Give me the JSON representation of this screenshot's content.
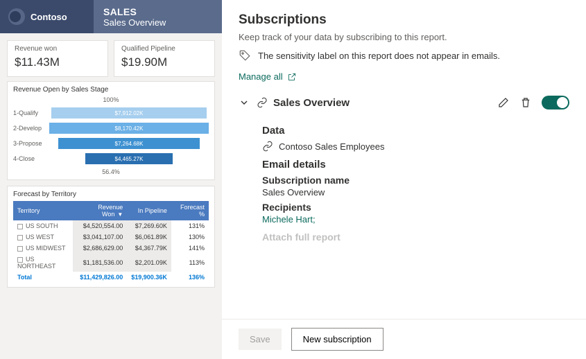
{
  "brand": {
    "name": "Contoso"
  },
  "nav": {
    "section": "SALES",
    "page": "Sales Overview"
  },
  "tiles": {
    "revenue_won": {
      "label": "Revenue won",
      "value": "$11.43M"
    },
    "qualified_pipeline": {
      "label": "Qualified Pipeline",
      "value": "$19.90M"
    }
  },
  "funnel": {
    "title": "Revenue Open by Sales Stage",
    "top_pct": "100%",
    "bottom_pct": "56.4%",
    "rows": [
      {
        "label": "1-Qualify",
        "value": "$7,912.02K"
      },
      {
        "label": "2-Develop",
        "value": "$8,170.42K"
      },
      {
        "label": "3-Propose",
        "value": "$7,264.68K"
      },
      {
        "label": "4-Close",
        "value": "$4,465.27K"
      }
    ]
  },
  "table": {
    "title": "Forecast by Territory",
    "cols": [
      "Territory",
      "Revenue Won",
      "In Pipeline",
      "Forecast %"
    ],
    "rows": [
      {
        "t": "US SOUTH",
        "rw": "$4,520,554.00",
        "ip": "$7,269.60K",
        "fp": "131%"
      },
      {
        "t": "US WEST",
        "rw": "$3,041,107.00",
        "ip": "$6,061.89K",
        "fp": "130%"
      },
      {
        "t": "US MIDWEST",
        "rw": "$2,686,629.00",
        "ip": "$4,367.79K",
        "fp": "141%"
      },
      {
        "t": "US NORTHEAST",
        "rw": "$1,181,536.00",
        "ip": "$2,201.09K",
        "fp": "113%"
      }
    ],
    "total": {
      "t": "Total",
      "rw": "$11,429,826.00",
      "ip": "$19,900.36K",
      "fp": "136%"
    }
  },
  "panel": {
    "title": "Subscriptions",
    "desc": "Keep track of your data by subscribing to this report.",
    "sensitivity": "The sensitivity label on this report does not appear in emails.",
    "manage_all": "Manage all",
    "subscription": {
      "title": "Sales Overview",
      "data_heading": "Data",
      "data_value": "Contoso Sales Employees",
      "email_heading": "Email details",
      "name_label": "Subscription name",
      "name_value": "Sales Overview",
      "recipients_label": "Recipients",
      "recipients_value": "Michele Hart;",
      "cutoff_label": "Attach full report"
    },
    "footer": {
      "save": "Save",
      "new_sub": "New subscription"
    }
  },
  "chart_data": {
    "type": "bar",
    "title": "Revenue Open by Sales Stage",
    "orientation": "horizontal-funnel",
    "categories": [
      "1-Qualify",
      "2-Develop",
      "3-Propose",
      "4-Close"
    ],
    "values": [
      7912.02,
      8170.42,
      7264.68,
      4465.27
    ],
    "unit": "K$",
    "top_pct": 100,
    "bottom_pct": 56.4
  }
}
